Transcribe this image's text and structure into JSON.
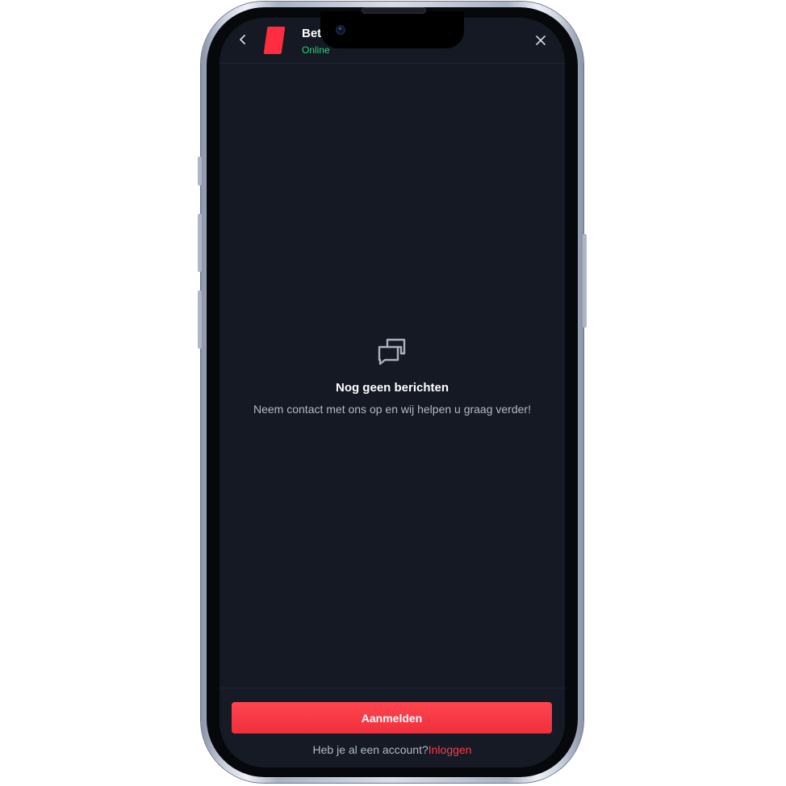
{
  "header": {
    "back_icon": "chevron-left-icon",
    "brand_name": "Bet",
    "status": "Online",
    "close_icon": "close-icon",
    "colors": {
      "status": "#2fd07a",
      "logo": "#ff2d3f"
    }
  },
  "empty_state": {
    "icon": "chat-bubbles-icon",
    "title": "Nog geen berichten",
    "subtitle": "Neem contact met ons op en wij helpen u graag verder!"
  },
  "footer": {
    "signup_label": "Aanmelden",
    "account_prompt": "Heb je al een account?",
    "login_label": "Inloggen",
    "colors": {
      "accent": "#ff3b47",
      "background": "#141924"
    }
  }
}
